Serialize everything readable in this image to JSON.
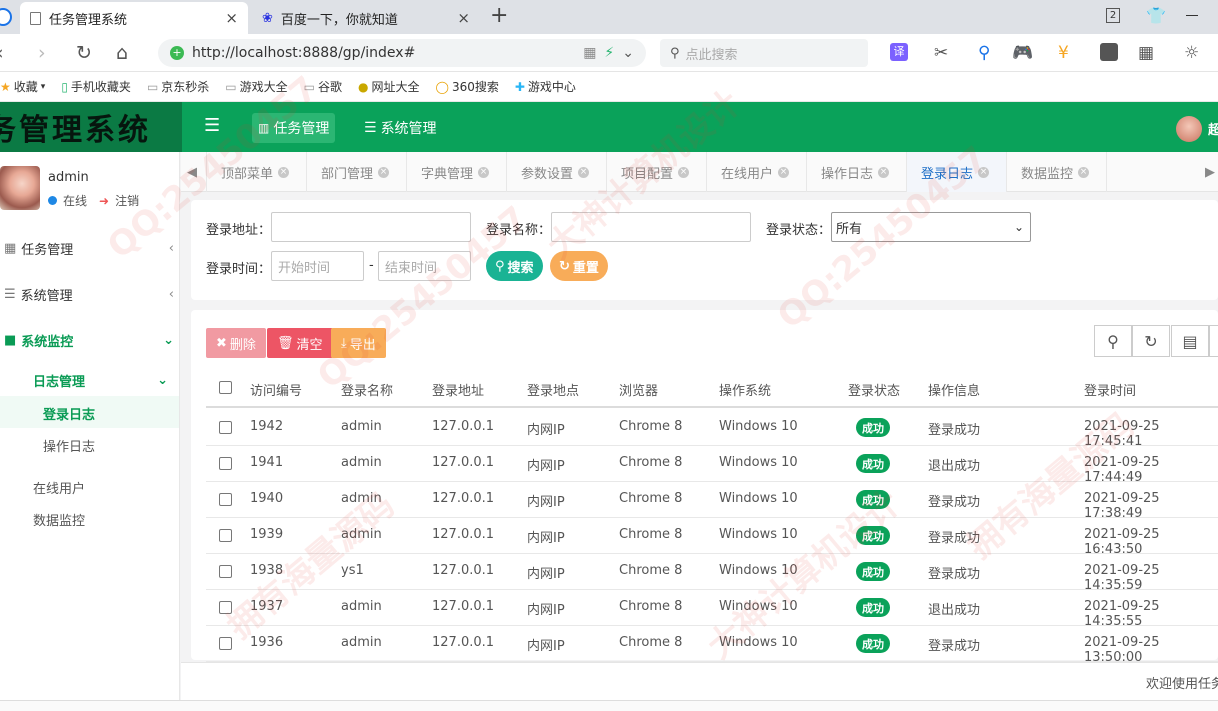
{
  "browser": {
    "tabs": [
      {
        "title": "任务管理系统",
        "close": "×"
      },
      {
        "title": "百度一下，你就知道",
        "close": "×"
      }
    ],
    "new_tab": "+",
    "url": "http://localhost:8888/gp/index#",
    "search_placeholder": "点此搜索",
    "tab_count": "2",
    "bookmarks": [
      "收藏",
      "手机收藏夹",
      "京东秒杀",
      "游戏大全",
      "谷歌",
      "网址大全",
      "360搜索",
      "游戏中心"
    ]
  },
  "app": {
    "logo_text": "务管理系统",
    "top_nav": [
      {
        "label": "任务管理",
        "icon": "bar-chart-icon"
      },
      {
        "label": "系统管理",
        "icon": "list-icon"
      }
    ],
    "user_initial": "超"
  },
  "sidebar": {
    "username": "admin",
    "status": "在线",
    "logout": "注销",
    "menu": [
      {
        "label": "任务管理"
      },
      {
        "label": "系统管理"
      },
      {
        "label": "系统监控"
      }
    ],
    "submenu_group": "日志管理",
    "sub_items": [
      "登录日志",
      "操作日志"
    ],
    "monitor_items": [
      "在线用户",
      "数据监控"
    ]
  },
  "page_tabs": [
    "顶部菜单",
    "部门管理",
    "字典管理",
    "参数设置",
    "项目配置",
    "在线用户",
    "操作日志",
    "登录日志",
    "数据监控"
  ],
  "active_tab": "登录日志",
  "search": {
    "addr_label": "登录地址：",
    "name_label": "登录名称：",
    "status_label": "登录状态：",
    "status_value": "所有",
    "time_label": "登录时间：",
    "start_placeholder": "开始时间",
    "end_placeholder": "结束时间",
    "sep": "-",
    "search_btn": "搜索",
    "reset_btn": "重置"
  },
  "toolbar": {
    "delete": "删除",
    "clear": "清空",
    "export": "导出"
  },
  "table": {
    "headers": [
      "访问编号",
      "登录名称",
      "登录地址",
      "登录地点",
      "浏览器",
      "操作系统",
      "登录状态",
      "操作信息",
      "登录时间"
    ],
    "rows": [
      {
        "id": "1942",
        "name": "admin",
        "ip": "127.0.0.1",
        "loc": "内网IP",
        "browser": "Chrome 8",
        "os": "Windows 10",
        "status": "成功",
        "msg": "登录成功",
        "time": "2021-09-25 17:45:41"
      },
      {
        "id": "1941",
        "name": "admin",
        "ip": "127.0.0.1",
        "loc": "内网IP",
        "browser": "Chrome 8",
        "os": "Windows 10",
        "status": "成功",
        "msg": "退出成功",
        "time": "2021-09-25 17:44:49"
      },
      {
        "id": "1940",
        "name": "admin",
        "ip": "127.0.0.1",
        "loc": "内网IP",
        "browser": "Chrome 8",
        "os": "Windows 10",
        "status": "成功",
        "msg": "登录成功",
        "time": "2021-09-25 17:38:49"
      },
      {
        "id": "1939",
        "name": "admin",
        "ip": "127.0.0.1",
        "loc": "内网IP",
        "browser": "Chrome 8",
        "os": "Windows 10",
        "status": "成功",
        "msg": "登录成功",
        "time": "2021-09-25 16:43:50"
      },
      {
        "id": "1938",
        "name": "ys1",
        "ip": "127.0.0.1",
        "loc": "内网IP",
        "browser": "Chrome 8",
        "os": "Windows 10",
        "status": "成功",
        "msg": "登录成功",
        "time": "2021-09-25 14:35:59"
      },
      {
        "id": "1937",
        "name": "admin",
        "ip": "127.0.0.1",
        "loc": "内网IP",
        "browser": "Chrome 8",
        "os": "Windows 10",
        "status": "成功",
        "msg": "退出成功",
        "time": "2021-09-25 14:35:55"
      },
      {
        "id": "1936",
        "name": "admin",
        "ip": "127.0.0.1",
        "loc": "内网IP",
        "browser": "Chrome 8",
        "os": "Windows 10",
        "status": "成功",
        "msg": "登录成功",
        "time": "2021-09-25 13:50:00"
      }
    ]
  },
  "footer": "欢迎使用任务",
  "colors": {
    "brand": "#0aa25a",
    "danger": "#ed5565",
    "warning": "#f8ac59",
    "link": "#1e6fc7"
  }
}
